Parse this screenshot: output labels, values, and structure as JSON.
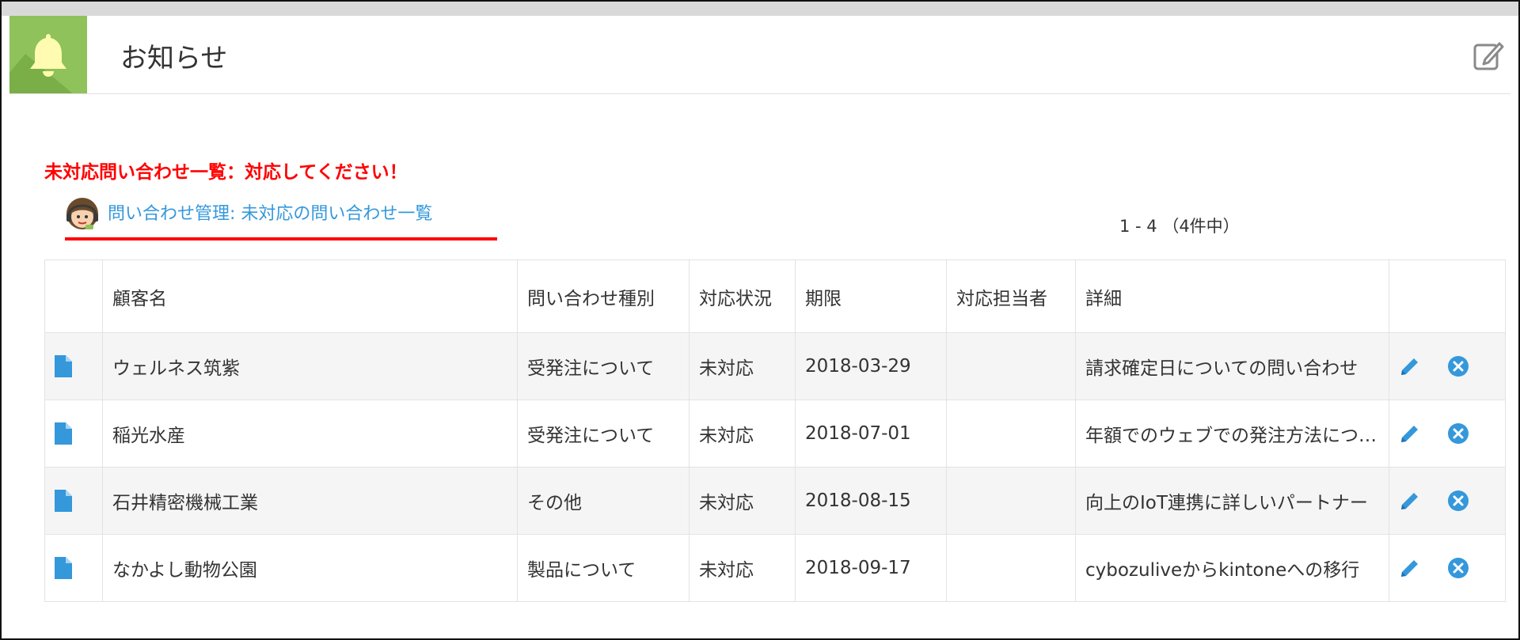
{
  "header": {
    "title": "お知らせ",
    "bell_icon": "bell-icon",
    "edit_icon": "edit-icon",
    "accent": "#8fc25a"
  },
  "notice": {
    "warning": "未対応問い合わせ一覧：対応してください！",
    "warning_color": "#ff0000",
    "link_text": "問い合わせ管理: 未対応の問い合わせ一覧",
    "link_color": "#3498db",
    "avatar_icon": "support-avatar-icon"
  },
  "pager": {
    "text": "1 - 4 （4件中）"
  },
  "table": {
    "headers": [
      "",
      "顧客名",
      "問い合わせ種別",
      "対応状況",
      "期限",
      "対応担当者",
      "詳細",
      ""
    ],
    "rows": [
      {
        "customer": "ウェルネス筑紫",
        "type": "受発注について",
        "status": "未対応",
        "deadline": "2018-03-29",
        "assignee": "",
        "detail": "請求確定日についての問い合わせ"
      },
      {
        "customer": "稲光水産",
        "type": "受発注について",
        "status": "未対応",
        "deadline": "2018-07-01",
        "assignee": "",
        "detail": "年額でのウェブでの発注方法について"
      },
      {
        "customer": "石井精密機械工業",
        "type": "その他",
        "status": "未対応",
        "deadline": "2018-08-15",
        "assignee": "",
        "detail": "向上のIoT連携に詳しいパートナー"
      },
      {
        "customer": "なかよし動物公園",
        "type": "製品について",
        "status": "未対応",
        "deadline": "2018-09-17",
        "assignee": "",
        "detail": "cybozuliveからkintoneへの移行"
      }
    ],
    "row_icons": {
      "record": "document-icon",
      "edit": "pencil-icon",
      "delete": "close-circle-icon"
    },
    "icon_color": "#3498db"
  }
}
